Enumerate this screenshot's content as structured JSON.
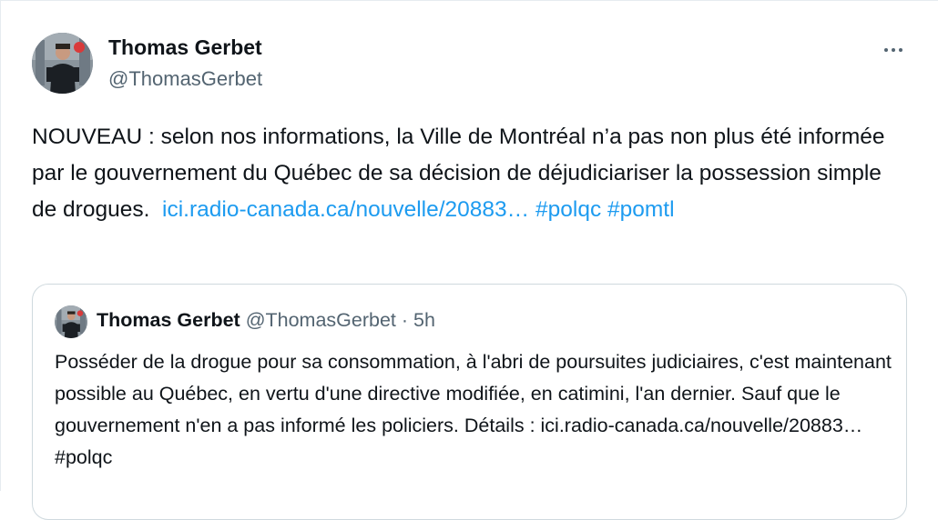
{
  "tweet": {
    "author_name": "Thomas Gerbet",
    "author_handle": "@ThomasGerbet",
    "more_icon": "more-horizontal-icon",
    "text_part1": "NOUVEAU : selon nos informations, la Ville de Montréal n’a pas non plus été informée par le gouvernement du Québec de sa décision de déjudiciariser la possession simple de drogues.",
    "link": "ici.radio-canada.ca/nouvelle/20883…",
    "hashtag1": "#polqc",
    "hashtag2": "#pomtl"
  },
  "quote": {
    "author_name": "Thomas Gerbet",
    "author_handle": "@ThomasGerbet",
    "separator": "·",
    "time": "5h",
    "text": "Posséder de la drogue pour sa consommation, à l'abri de poursuites judiciaires, c'est maintenant possible au Québec, en vertu d'une directive modifiée, en catimini, l'an dernier. Sauf que le gouvernement n'en a pas informé les policiers. Détails : ici.radio-canada.ca/nouvelle/20883… #polqc"
  },
  "colors": {
    "link": "#1d9bf0",
    "secondary_text": "#536471",
    "border": "#cfd9de"
  }
}
